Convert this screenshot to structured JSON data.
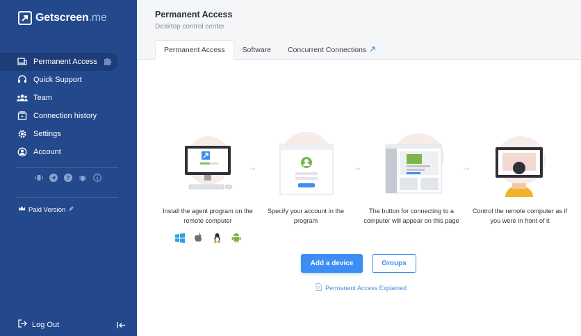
{
  "brand": {
    "name": "Getscreen",
    "suffix": ".me"
  },
  "sidebar": {
    "items": [
      {
        "label": "Permanent Access",
        "icon": "devices-icon"
      },
      {
        "label": "Quick Support",
        "icon": "headset-icon"
      },
      {
        "label": "Team",
        "icon": "team-icon"
      },
      {
        "label": "Connection history",
        "icon": "history-icon"
      },
      {
        "label": "Settings",
        "icon": "gear-icon"
      },
      {
        "label": "Account",
        "icon": "user-icon"
      }
    ],
    "paid_label": "Paid Version",
    "logout_label": "Log Out"
  },
  "header": {
    "title": "Permanent Access",
    "subtitle": "Desktop control center",
    "tabs": [
      {
        "label": "Permanent Access"
      },
      {
        "label": "Software"
      },
      {
        "label": "Concurrent Connections"
      }
    ]
  },
  "steps": [
    {
      "text": "Install the agent program on the remote computer"
    },
    {
      "text": "Specify your account in the program"
    },
    {
      "text": "The button for connecting to a computer will appear on this page"
    },
    {
      "text": "Control the remote computer as if you were in front of it"
    }
  ],
  "os": [
    "windows-icon",
    "apple-icon",
    "linux-icon",
    "android-icon"
  ],
  "buttons": {
    "add": "Add a device",
    "groups": "Groups"
  },
  "link": {
    "explained": "Permanent Access Explained"
  },
  "colors": {
    "sidebar": "#23498c",
    "accent": "#3d8ef2"
  }
}
